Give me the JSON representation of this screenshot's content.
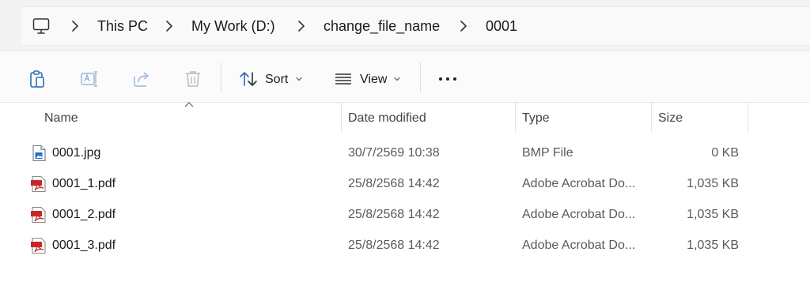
{
  "breadcrumb": {
    "icon": "computer-icon",
    "items": [
      "This PC",
      "My Work (D:)",
      "change_file_name",
      "0001"
    ]
  },
  "toolbar": {
    "sort_label": "Sort",
    "view_label": "View",
    "buttons": [
      "paste-icon",
      "rename-icon",
      "share-icon",
      "delete-icon"
    ],
    "more_icon": "more-options-icon"
  },
  "columns": {
    "name": "Name",
    "date": "Date modified",
    "type": "Type",
    "size": "Size"
  },
  "files": [
    {
      "name": "0001.jpg",
      "date": "30/7/2569 10:38",
      "type": "BMP File",
      "size": "0 KB",
      "icon": "image-file-icon"
    },
    {
      "name": "0001_1.pdf",
      "date": "25/8/2568 14:42",
      "type": "Adobe Acrobat Do...",
      "size": "1,035 KB",
      "icon": "pdf-file-icon"
    },
    {
      "name": "0001_2.pdf",
      "date": "25/8/2568 14:42",
      "type": "Adobe Acrobat Do...",
      "size": "1,035 KB",
      "icon": "pdf-file-icon"
    },
    {
      "name": "0001_3.pdf",
      "date": "25/8/2568 14:42",
      "type": "Adobe Acrobat Do...",
      "size": "1,035 KB",
      "icon": "pdf-file-icon"
    }
  ],
  "colors": {
    "pdf_red": "#c62828",
    "image_blue": "#1e6fd0",
    "disabled_icon": "#9bb7d6"
  }
}
